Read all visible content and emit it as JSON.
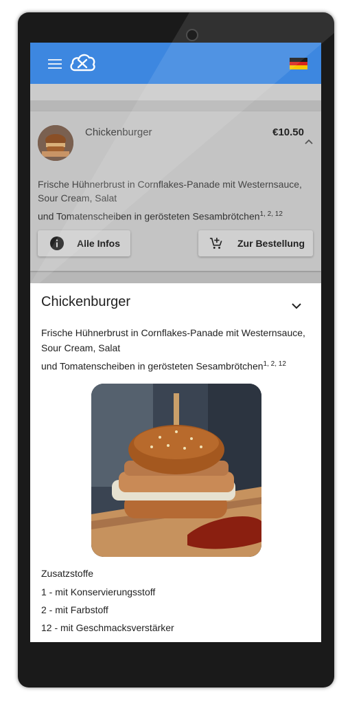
{
  "app": {
    "logo_icon": "cloud-food-logo-icon",
    "menu_icon": "hamburger-menu-icon",
    "language_flag": "german-flag-icon",
    "accent_color": "#3d87e0"
  },
  "card": {
    "title": "Chickenburger",
    "price": "€10.50",
    "desc_line1": "Frische Hühnerbrust in Cornflakes-Panade mit Westernsauce, Sour Cream, Salat",
    "desc_line2": "und Tomatenscheiben in gerösteten Sesambrötchen",
    "desc_sup": "1, 2, 12",
    "info_button": "Alle Infos",
    "order_button": "Zur Bestellung"
  },
  "sheet": {
    "title": "Chickenburger",
    "desc_line1": "Frische Hühnerbrust in Cornflakes-Panade mit Westernsauce, Sour Cream, Salat",
    "desc_line2": "und Tomatenscheiben in gerösteten Sesambrötchen",
    "desc_sup": "1, 2, 12",
    "additives_title": "Zusatzstoffe",
    "additives": [
      "1 - mit Konservierungsstoff",
      "2 - mit Farbstoff",
      "12 - mit Geschmacksverstärker"
    ]
  }
}
